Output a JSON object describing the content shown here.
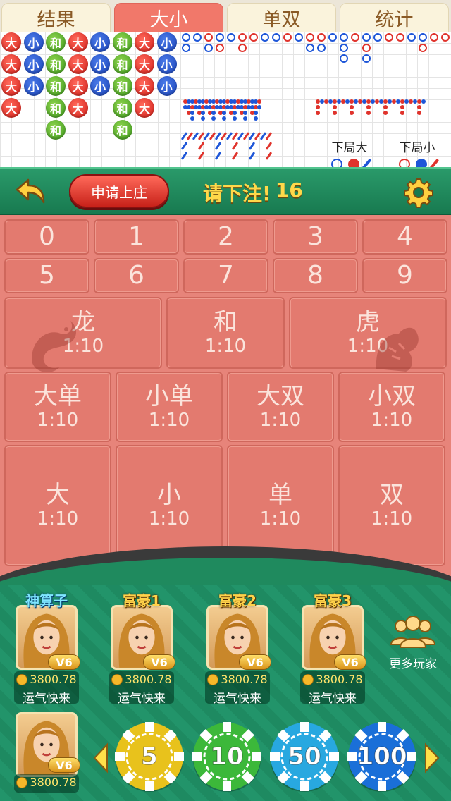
{
  "tabs": [
    "结果",
    "大小",
    "单双",
    "统计"
  ],
  "active_tab": 1,
  "road": {
    "beads": [
      [
        "大",
        "大",
        "大",
        "大"
      ],
      [
        "小",
        "小",
        "小",
        ""
      ],
      [
        "和",
        "和",
        "和",
        "和",
        "和"
      ],
      [
        "大",
        "大",
        "大",
        "大"
      ],
      [
        "小",
        "小",
        "小",
        ""
      ],
      [
        "和",
        "和",
        "和",
        "和",
        "和"
      ],
      [
        "大",
        "大",
        "大",
        "大"
      ],
      [
        "小",
        "小",
        "小",
        ""
      ]
    ],
    "next_big_label": "下局大",
    "next_small_label": "下局小"
  },
  "header": {
    "apply_label": "申请上庄",
    "prompt_label": "请下注!",
    "countdown": "16"
  },
  "table": {
    "numbers": [
      "0",
      "1",
      "2",
      "3",
      "4",
      "5",
      "6",
      "7",
      "8",
      "9"
    ],
    "dragon_tiger": [
      {
        "name": "龙",
        "odds": "1:10"
      },
      {
        "name": "和",
        "odds": "1:10"
      },
      {
        "name": "虎",
        "odds": "1:10"
      }
    ],
    "combos": [
      {
        "name": "大单",
        "odds": "1:10"
      },
      {
        "name": "小单",
        "odds": "1:10"
      },
      {
        "name": "大双",
        "odds": "1:10"
      },
      {
        "name": "小双",
        "odds": "1:10"
      }
    ],
    "basic": [
      {
        "name": "大",
        "odds": "1:10"
      },
      {
        "name": "小",
        "odds": "1:10"
      },
      {
        "name": "单",
        "odds": "1:10"
      },
      {
        "name": "双",
        "odds": "1:10"
      }
    ]
  },
  "players": [
    {
      "title": "神算子",
      "vip": "V6",
      "coins": "3800.78",
      "status": "运气快来"
    },
    {
      "title": "富豪1",
      "vip": "V6",
      "coins": "3800.78",
      "status": "运气快来"
    },
    {
      "title": "富豪2",
      "vip": "V6",
      "coins": "3800.78",
      "status": "运气快来"
    },
    {
      "title": "富豪3",
      "vip": "V6",
      "coins": "3800.78",
      "status": "运气快来"
    }
  ],
  "more_players_label": "更多玩家",
  "self": {
    "vip": "V6",
    "coins": "3800.78"
  },
  "chips": [
    {
      "value": "5",
      "color": "#e8c21c"
    },
    {
      "value": "10",
      "color": "#3cb83a"
    },
    {
      "value": "50",
      "color": "#28a8e0"
    },
    {
      "value": "100",
      "color": "#1a6fd8"
    }
  ],
  "icons": {
    "back": "back-arrow-icon",
    "settings": "gear-icon",
    "more": "players-group-icon"
  }
}
